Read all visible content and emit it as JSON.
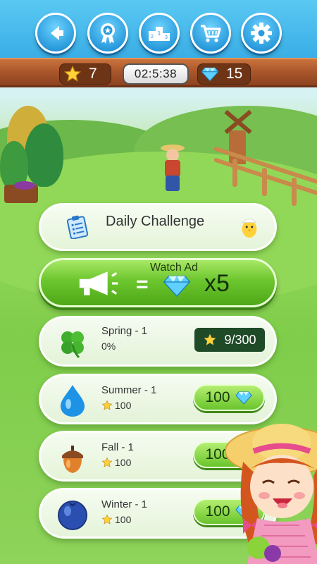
{
  "header": {
    "stars": "7",
    "timer": "02:5:38",
    "gems": "15",
    "buttons": [
      "back-icon",
      "award-icon",
      "leaderboard-icon",
      "shop-cart-icon",
      "settings-gear-icon"
    ]
  },
  "menu": {
    "daily_challenge": "Daily Challenge",
    "watch_ad": {
      "label": "Watch Ad",
      "equals": "=",
      "multiplier": "x5"
    }
  },
  "levels": [
    {
      "name": "Spring - 1",
      "status": "0%",
      "progress": "9/300",
      "icon": "clover-icon"
    },
    {
      "name": "Summer - 1",
      "cost_stars": "100",
      "price": "100",
      "icon": "water-drop-icon"
    },
    {
      "name": "Fall - 1",
      "cost_stars": "100",
      "price": "100",
      "icon": "acorn-icon"
    },
    {
      "name": "Winter - 1",
      "cost_stars": "100",
      "price": "100",
      "icon": "blueberry-icon"
    }
  ],
  "colors": {
    "sky_blue": "#39aee6",
    "wood_brown": "#a8552a",
    "grass_green": "#7fcd4a",
    "button_green": "#69c42b",
    "dark_green": "#1f4a27"
  }
}
